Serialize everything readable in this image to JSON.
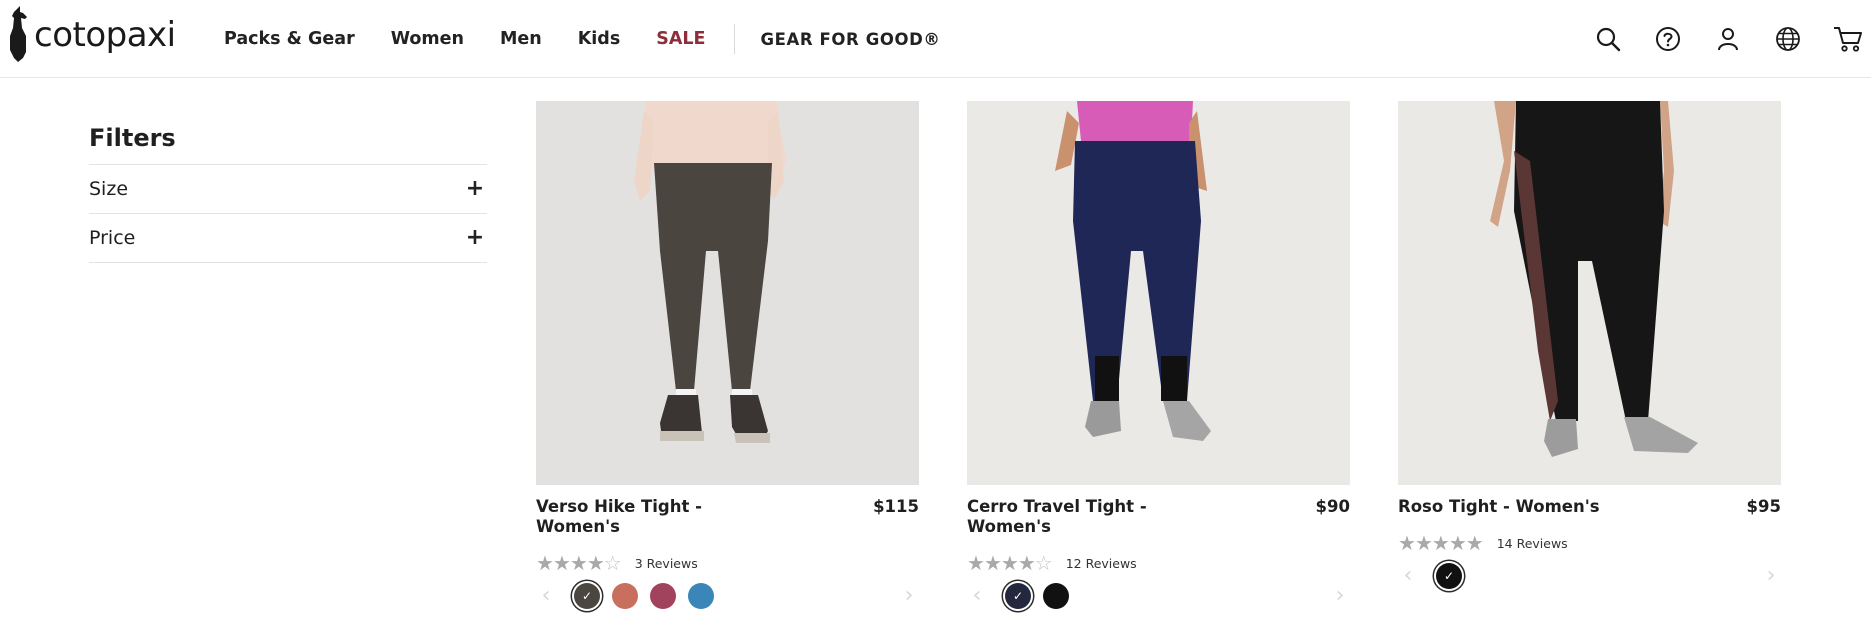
{
  "brand": {
    "name": "cotopaxi"
  },
  "nav": {
    "items": [
      "Packs & Gear",
      "Women",
      "Men",
      "Kids"
    ],
    "sale": "SALE",
    "gear_for_good": "GEAR FOR GOOD®"
  },
  "header_icons": [
    "search-icon",
    "help-icon",
    "account-icon",
    "globe-icon",
    "cart-icon"
  ],
  "filters": {
    "title": "Filters",
    "groups": [
      {
        "label": "Size",
        "toggle": "+"
      },
      {
        "label": "Price",
        "toggle": "+"
      }
    ]
  },
  "products": [
    {
      "name": "Verso Hike Tight - Women's",
      "price": "$115",
      "rating": 4,
      "reviews": "3 Reviews",
      "swatches": [
        "#4b4640",
        "#c8705d",
        "#a2435e",
        "#3a86b8"
      ],
      "selected": 0,
      "photo": {
        "bg": "#e3e1e0",
        "top": "#f0d9cc",
        "legs": "#4a453f"
      }
    },
    {
      "name": "Cerro Travel Tight - Women's",
      "price": "$90",
      "rating": 4,
      "reviews": "12 Reviews",
      "swatches": [
        "#23283f",
        "#111111"
      ],
      "selected": 0,
      "photo": {
        "bg": "#ebe9e6",
        "top": "#d65cb8",
        "legs": "#1e2755"
      }
    },
    {
      "name": "Roso Tight - Women's",
      "price": "$95",
      "rating": 5,
      "reviews": "14 Reviews",
      "swatches": [
        "#111111"
      ],
      "selected": 0,
      "photo": {
        "bg": "#ebe9e6",
        "top": "#1a1a1a",
        "legs": "#161616"
      }
    }
  ],
  "colors": {
    "sale": "#8b2f3a",
    "text": "#1f1f1f"
  }
}
